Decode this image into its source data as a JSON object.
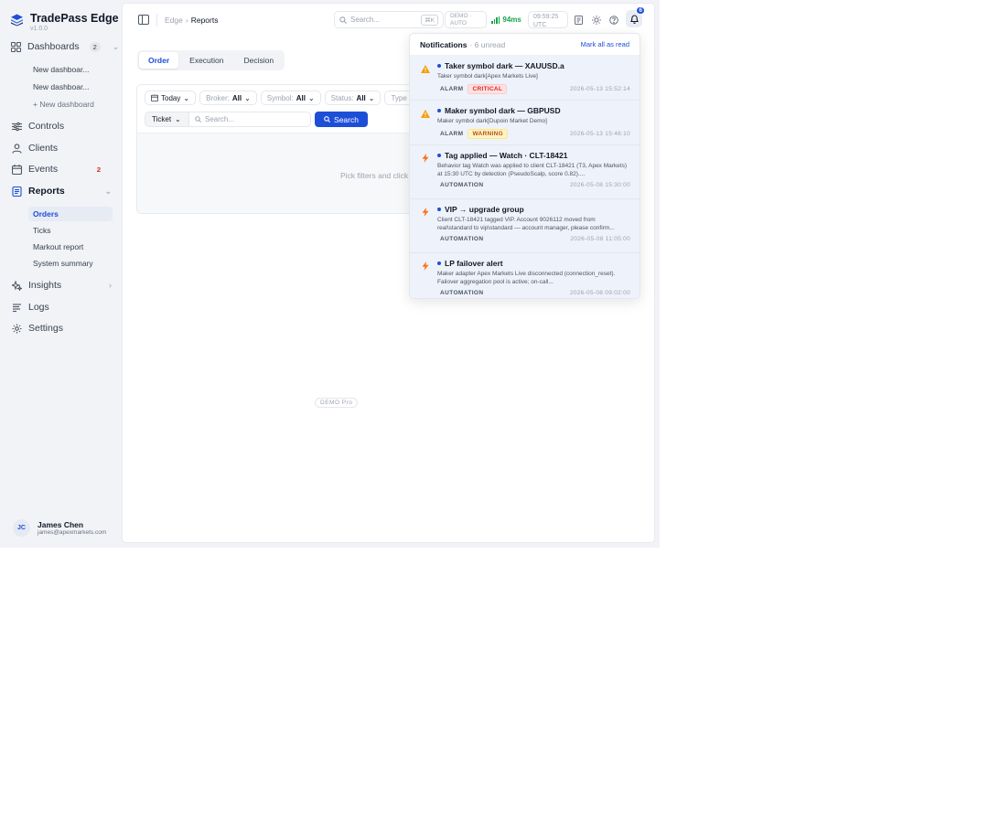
{
  "brand": {
    "name": "TradePass Edge",
    "version": "v1.0.0"
  },
  "sidebar": {
    "dashboards": {
      "label": "Dashboards",
      "count": "2"
    },
    "dashboard_items": [
      "New dashboar...",
      "New dashboar...",
      "+ New dashboard"
    ],
    "controls": "Controls",
    "clients": "Clients",
    "events": {
      "label": "Events",
      "count": "2"
    },
    "reports": "Reports",
    "report_items": [
      "Orders",
      "Ticks",
      "Markout report",
      "System summary"
    ],
    "insights": "Insights",
    "logs": "Logs",
    "settings": "Settings"
  },
  "user": {
    "initials": "JC",
    "name": "James Chen",
    "email": "james@apexmarkets.com"
  },
  "topbar": {
    "breadcrumb": [
      "Edge",
      "Reports"
    ],
    "search_placeholder": "Search...",
    "shortcut": "⌘K",
    "env_line1": "DEMO ·",
    "env_line2": "AUTO",
    "latency": "94ms",
    "clock_time": "09:59:25",
    "clock_zone": "UTC",
    "bell_count": "6"
  },
  "tabs": [
    "Order",
    "Execution",
    "Decision"
  ],
  "filters": {
    "date": "Today",
    "broker_label": "Broker:",
    "broker_value": "All",
    "symbol_label": "Symbol:",
    "symbol_value": "All",
    "status_label": "Status:",
    "status_value": "All",
    "type_label": "Type",
    "ticket_label": "Ticket",
    "search_placeholder": "Search...",
    "search_button": "Search",
    "empty_text": "Pick filters and click"
  },
  "demo_tag": "DEMO Pro",
  "notifications": {
    "title": "Notifications",
    "unread": "· 6 unread",
    "mark_all": "Mark all as read",
    "items": [
      {
        "icon": "warning-icon",
        "title": "Taker symbol dark — XAUUSD.a",
        "desc": "Taker symbol dark[Apex Markets Live]",
        "category": "ALARM",
        "severity": "CRITICAL",
        "time": "2026-05-13 15:52:14"
      },
      {
        "icon": "warning-icon",
        "title": "Maker symbol dark — GBPUSD",
        "desc": "Maker symbol dark[Dupoin Market Demo]",
        "category": "ALARM",
        "severity": "WARNING",
        "time": "2026-05-13 15:46:10"
      },
      {
        "icon": "bolt-icon",
        "title": "Tag applied — Watch · CLT-18421",
        "desc": "Behavior tag Watch was applied to client CLT-18421 (T3, Apex Markets) at 15:30 UTC by detection (PseudoScalp, score 0.82)....",
        "category": "AUTOMATION",
        "severity": "",
        "time": "2026-05-08 15:30:00"
      },
      {
        "icon": "bolt-icon",
        "title": "VIP → upgrade group",
        "desc": "Client CLT-18421 tagged VIP. Account 9026112 moved from real\\standard to vip\\standard — account manager, please confirm...",
        "category": "AUTOMATION",
        "severity": "",
        "time": "2026-05-08 11:05:00"
      },
      {
        "icon": "bolt-icon",
        "title": "LP failover alert",
        "desc": "Maker adapter Apex Markets Live disconnected (connection_reset). Failover aggregation pool is active; on-call...",
        "category": "AUTOMATION",
        "severity": "",
        "time": "2026-05-08 09:02:00"
      }
    ]
  },
  "colors": {
    "accent": "#1d4ed8",
    "critical": "#dc2626",
    "warning": "#b45309",
    "ok": "#16a34a"
  }
}
